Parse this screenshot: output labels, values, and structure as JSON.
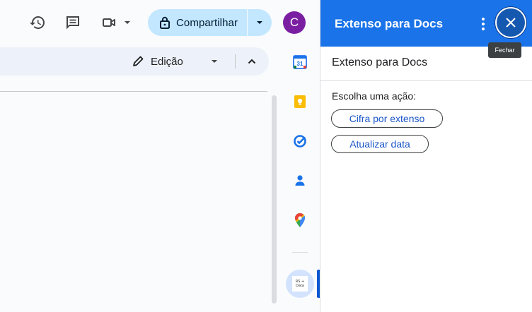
{
  "toolbar": {
    "share_label": "Compartilhar",
    "avatar_initial": "C"
  },
  "format_bar": {
    "mode_label": "Edição"
  },
  "rail": {
    "calendar_day": "31",
    "addon_logo_text": "RS + Data"
  },
  "panel": {
    "title": "Extenso para Docs",
    "close_tooltip": "Fechar",
    "subtitle": "Extenso para Docs",
    "prompt": "Escolha uma ação:",
    "actions": [
      {
        "label": "Cifra por extenso"
      },
      {
        "label": "Atualizar data"
      }
    ]
  },
  "colors": {
    "panel_header": "#1a73e8",
    "share_button": "#c2e7ff",
    "avatar": "#7b1fa2",
    "action_text": "#1a56c8"
  },
  "icons": [
    "history-icon",
    "comment-icon",
    "video-call-icon",
    "lock-icon",
    "pencil-icon",
    "chevron-up-icon",
    "calendar-icon",
    "keep-icon",
    "tasks-icon",
    "contacts-icon",
    "maps-icon",
    "more-vert-icon",
    "close-icon"
  ]
}
